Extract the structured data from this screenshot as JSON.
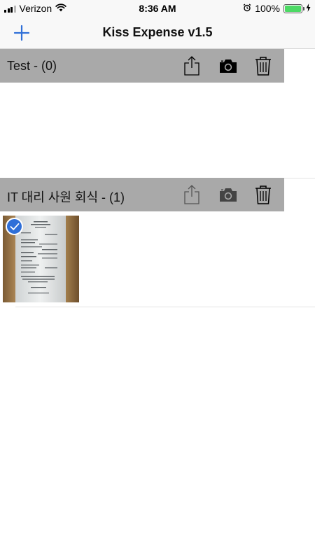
{
  "status_bar": {
    "carrier": "Verizon",
    "time": "8:36 AM",
    "battery": "100%",
    "signal_strength": 3,
    "icons": [
      "wifi-icon",
      "alarm-icon",
      "battery-icon",
      "charging-bolt-icon"
    ]
  },
  "nav": {
    "title": "Kiss Expense v1.5",
    "add_icon": "plus-icon"
  },
  "sections": [
    {
      "title": "Test - (0)",
      "icons": [
        "share-icon",
        "camera-icon",
        "trash-icon"
      ],
      "receipts": []
    },
    {
      "title": "IT 대리 사원 회식 - (1)",
      "icons": [
        "share-icon",
        "camera-icon",
        "trash-icon"
      ],
      "receipts": [
        {
          "selected": true,
          "icon": "receipt-photo"
        }
      ]
    }
  ],
  "colors": {
    "accent": "#2f6fd8",
    "section_header_bg": "#a9a9a9",
    "nav_bg": "#f8f8f8",
    "battery": "#4cd964"
  }
}
